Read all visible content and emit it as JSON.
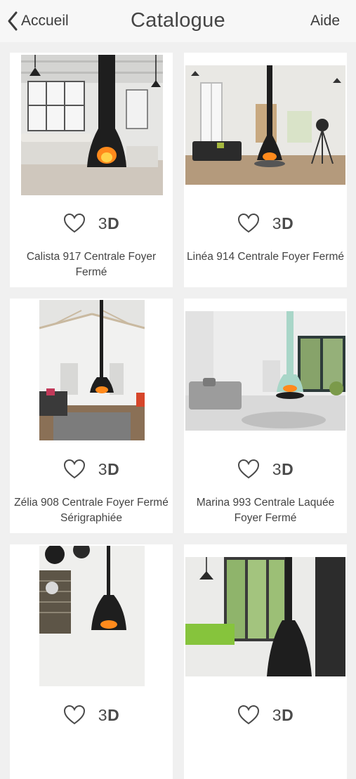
{
  "nav": {
    "back_label": "Accueil",
    "title": "Catalogue",
    "help_label": "Aide"
  },
  "products": [
    {
      "name": "Calista 917 Centrale Foyer Fermé",
      "badge": "3D",
      "favorite": false
    },
    {
      "name": "Linéa 914 Centrale Foyer Fermé",
      "badge": "3D",
      "favorite": false
    },
    {
      "name": "Zélia 908 Centrale Foyer Fermé Sérigraphiée",
      "badge": "3D",
      "favorite": false
    },
    {
      "name": "Marina 993 Centrale Laquée Foyer Fermé",
      "badge": "3D",
      "favorite": false
    },
    {
      "name": "",
      "badge": "3D",
      "favorite": false
    },
    {
      "name": "",
      "badge": "3D",
      "favorite": false
    }
  ],
  "icons": {
    "back": "chevron-left-icon",
    "favorite": "heart-outline-icon"
  },
  "colors": {
    "background": "#f0f0f0",
    "nav_background": "#f7f7f7",
    "card": "#ffffff",
    "text": "#444444",
    "fireplace_black": "#1e1e1e",
    "fireplace_mint": "#a9d6c8",
    "fire": "#ff8a1c"
  }
}
